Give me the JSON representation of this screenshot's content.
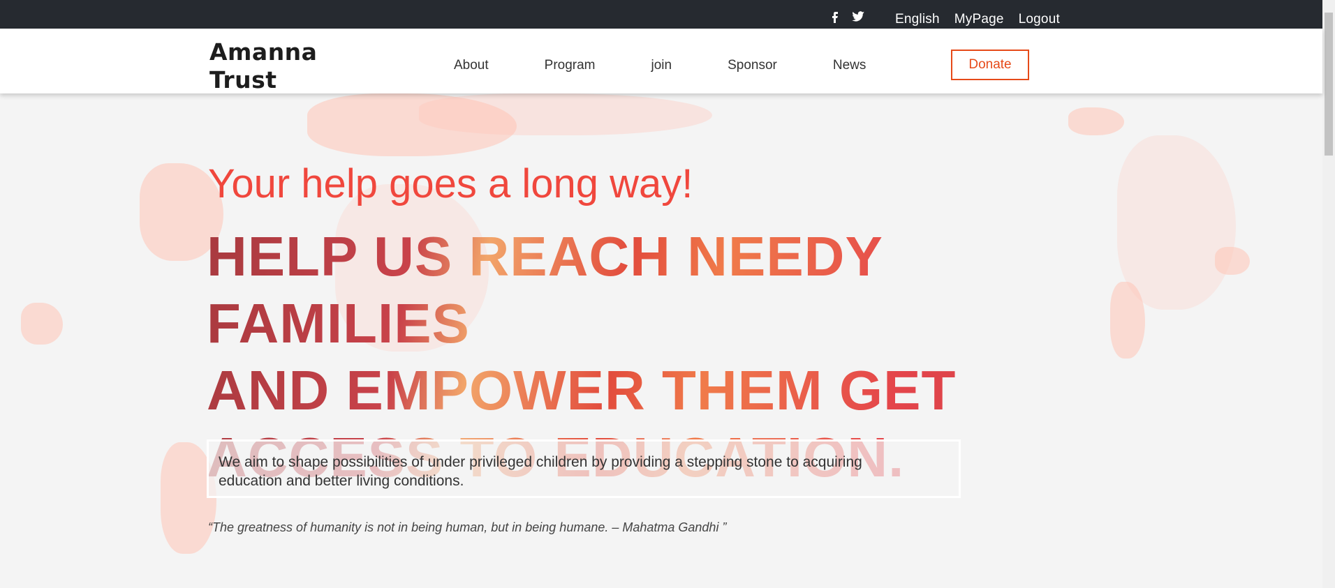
{
  "topbar": {
    "social": [
      {
        "name": "facebook-icon"
      },
      {
        "name": "twitter-icon"
      }
    ],
    "links": [
      "English",
      "MyPage",
      "Logout"
    ]
  },
  "header": {
    "brand_line1": "Amanna",
    "brand_line2": "Trust",
    "nav": [
      "About",
      "Program",
      "join",
      "Sponsor",
      "News"
    ],
    "donate": "Donate"
  },
  "hero": {
    "subtitle": "Your help goes a long way!",
    "headline_lines": [
      "HELP US REACH NEEDY FAMILIES",
      "AND EMPOWER THEM GET",
      "ACCESS TO EDUCATION."
    ],
    "mission_line1": "We aim to shape possibilities of under privileged children by providing a stepping stone to acquiring",
    "mission_line2": "education and better living conditions.",
    "quote": "“The greatness of humanity is not in being human, but in being humane. – Mahatma Gandhi ”"
  },
  "colors": {
    "topbar": "#262a30",
    "accent": "#e64a19",
    "subtitle": "#f0473d"
  }
}
